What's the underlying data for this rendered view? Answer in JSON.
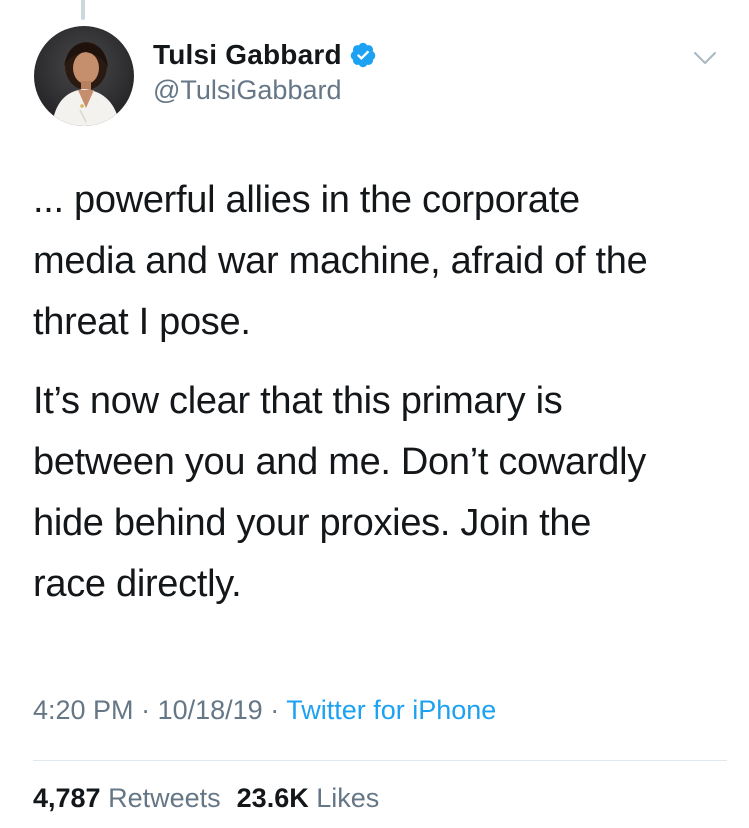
{
  "author": {
    "display_name": "Tulsi Gabbard",
    "handle": "@TulsiGabbard",
    "verified": true,
    "avatar_icon": "profile-photo",
    "verified_icon": "verified-badge-icon"
  },
  "tweet": {
    "paragraphs": [
      "... powerful allies in the corporate\nmedia and war machine, afraid of the\nthreat I pose.",
      "It’s now clear that this primary is\nbetween you and me. Don’t cowardly\nhide behind your proxies. Join the\nrace directly."
    ],
    "time": "4:20 PM",
    "date": "10/18/19",
    "separator": "·",
    "source": "Twitter for iPhone"
  },
  "stats": {
    "retweets_count": "4,787",
    "retweets_label": "Retweets",
    "likes_count": "23.6K",
    "likes_label": "Likes"
  },
  "colors": {
    "text": "#14171a",
    "secondary": "#657786",
    "accent": "#1da1f2",
    "divider": "#e1e8ed"
  }
}
